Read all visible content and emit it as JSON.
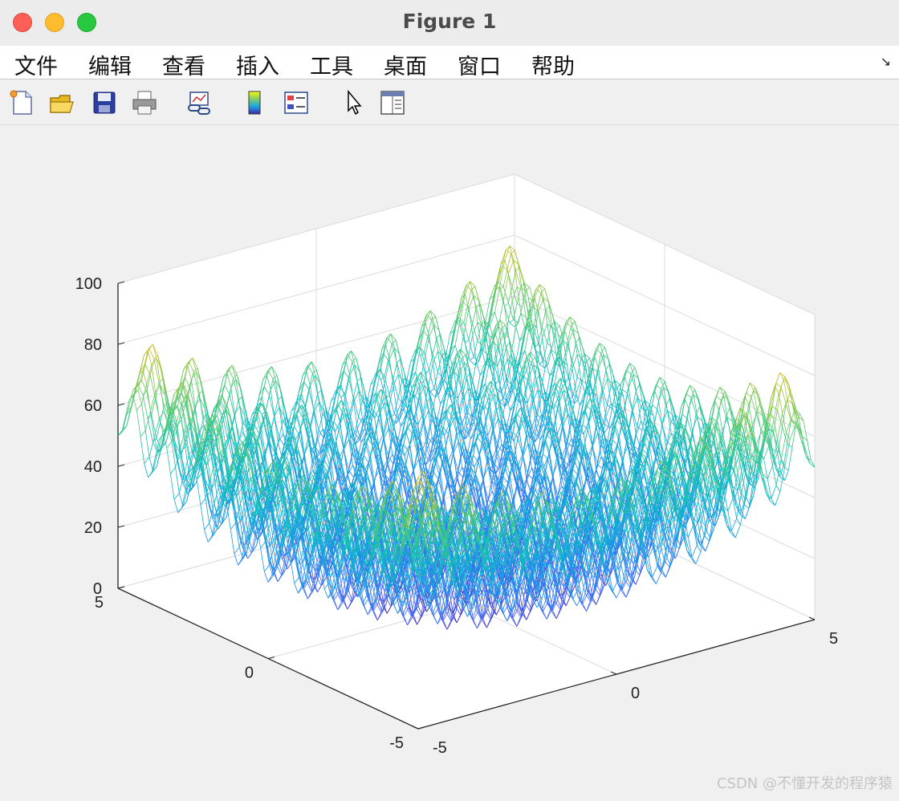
{
  "window": {
    "title": "Figure 1"
  },
  "menu": {
    "items": [
      "文件",
      "编辑",
      "查看",
      "插入",
      "工具",
      "桌面",
      "窗口",
      "帮助"
    ]
  },
  "toolbar": {
    "icons": [
      "new-figure-icon",
      "open-file-icon",
      "save-icon",
      "print-icon",
      "link-plot-icon",
      "colorbar-icon",
      "legend-icon",
      "pointer-icon",
      "property-editor-icon"
    ]
  },
  "chart_data": {
    "type": "mesh",
    "function": "Rastrigin: z = 20 + x^2 + y^2 - 10*(cos(2*pi*x) + cos(2*pi*y))",
    "x": [
      -5,
      5
    ],
    "y": [
      -5,
      5
    ],
    "zlim": [
      0,
      100
    ],
    "x_ticks": [
      "-5",
      "0",
      "5"
    ],
    "y_ticks": [
      "-5",
      "0",
      "5"
    ],
    "z_ticks": [
      "0",
      "20",
      "40",
      "60",
      "80",
      "100"
    ],
    "colormap": "parula",
    "grid": true
  },
  "watermark": "CSDN @不懂开发的程序猿"
}
